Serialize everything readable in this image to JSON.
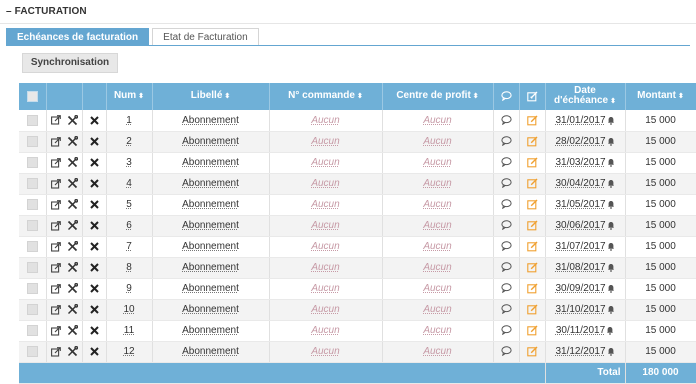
{
  "section": {
    "collapse_symbol": "–",
    "title": "FACTURATION"
  },
  "tabs": [
    {
      "label": "Echéances de facturation",
      "active": true
    },
    {
      "label": "Etat de Facturation",
      "active": false
    }
  ],
  "toolbar": {
    "sync_label": "Synchronisation"
  },
  "columns": {
    "num": "Num",
    "libelle": "Libellé",
    "commande": "N° commande",
    "centre": "Centre de profit",
    "date_line1": "Date",
    "date_line2": "d'échéance",
    "montant": "Montant",
    "sort_symbol": "⬍"
  },
  "rows": [
    {
      "num": "1",
      "libelle": "Abonnement",
      "commande": "Aucun",
      "centre": "Aucun",
      "date": "31/01/2017",
      "montant": "15 000"
    },
    {
      "num": "2",
      "libelle": "Abonnement",
      "commande": "Aucun",
      "centre": "Aucun",
      "date": "28/02/2017",
      "montant": "15 000"
    },
    {
      "num": "3",
      "libelle": "Abonnement",
      "commande": "Aucun",
      "centre": "Aucun",
      "date": "31/03/2017",
      "montant": "15 000"
    },
    {
      "num": "4",
      "libelle": "Abonnement",
      "commande": "Aucun",
      "centre": "Aucun",
      "date": "30/04/2017",
      "montant": "15 000"
    },
    {
      "num": "5",
      "libelle": "Abonnement",
      "commande": "Aucun",
      "centre": "Aucun",
      "date": "31/05/2017",
      "montant": "15 000"
    },
    {
      "num": "6",
      "libelle": "Abonnement",
      "commande": "Aucun",
      "centre": "Aucun",
      "date": "30/06/2017",
      "montant": "15 000"
    },
    {
      "num": "7",
      "libelle": "Abonnement",
      "commande": "Aucun",
      "centre": "Aucun",
      "date": "31/07/2017",
      "montant": "15 000"
    },
    {
      "num": "8",
      "libelle": "Abonnement",
      "commande": "Aucun",
      "centre": "Aucun",
      "date": "31/08/2017",
      "montant": "15 000"
    },
    {
      "num": "9",
      "libelle": "Abonnement",
      "commande": "Aucun",
      "centre": "Aucun",
      "date": "30/09/2017",
      "montant": "15 000"
    },
    {
      "num": "10",
      "libelle": "Abonnement",
      "commande": "Aucun",
      "centre": "Aucun",
      "date": "31/10/2017",
      "montant": "15 000"
    },
    {
      "num": "11",
      "libelle": "Abonnement",
      "commande": "Aucun",
      "centre": "Aucun",
      "date": "30/11/2017",
      "montant": "15 000"
    },
    {
      "num": "12",
      "libelle": "Abonnement",
      "commande": "Aucun",
      "centre": "Aucun",
      "date": "31/12/2017",
      "montant": "15 000"
    }
  ],
  "footer": {
    "total_label": "Total",
    "total_value": "180 000"
  },
  "icons": {
    "row_actions": [
      "open-external-icon",
      "tools-icon",
      "delete-icon"
    ],
    "comment": "comment-icon",
    "edit": "edit-icon",
    "date_alert": "bell-icon"
  },
  "colors": {
    "accent": "#6fb0d7",
    "edit_icon": "#f0a030",
    "empty_value": "#c79aa6"
  }
}
